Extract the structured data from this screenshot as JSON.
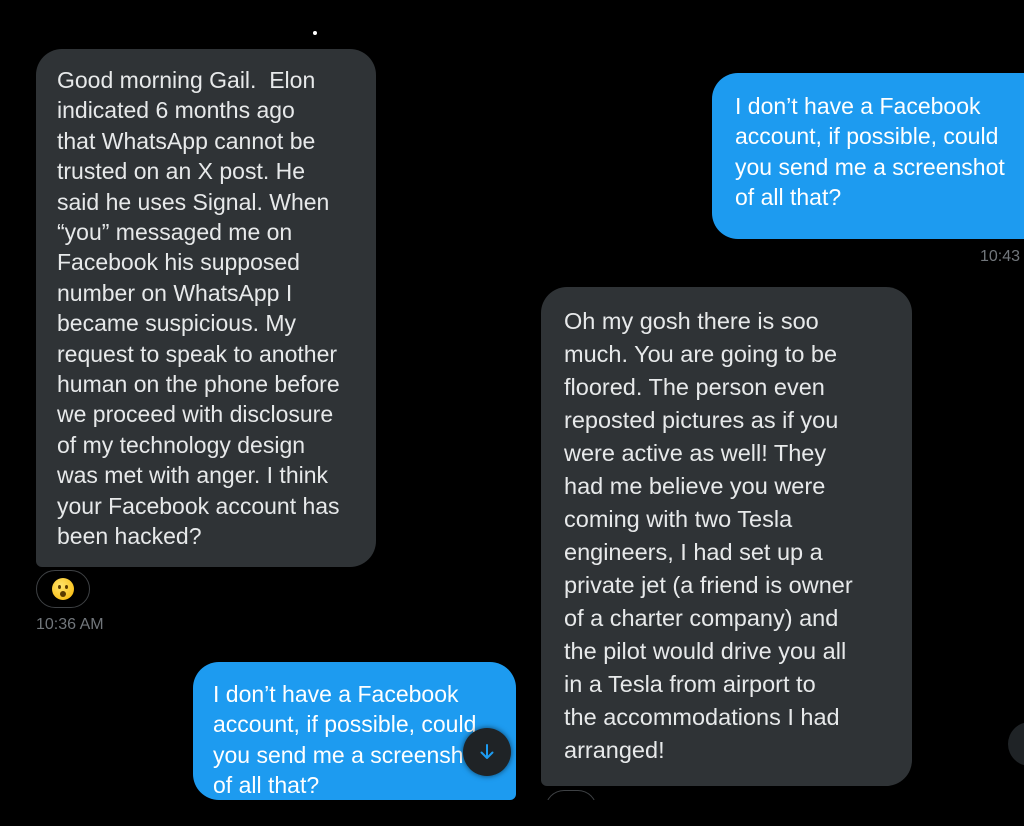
{
  "messages": {
    "gail": {
      "text": "Good morning Gail.  Elon\nindicated 6 months ago\nthat WhatsApp cannot be\ntrusted on an X post. He\nsaid he uses Signal. When\n“you” messaged me on\nFacebook his supposed\nnumber on WhatsApp I\nbecame suspicious. My\nrequest to speak to another\nhuman on the phone before\nwe proceed with disclosure\nof my technology design\nwas met with anger. I think\nyour Facebook account has\nbeen hacked?",
      "reaction": "astonished-face",
      "timestamp": "10:36 AM"
    },
    "outgoing_top": {
      "text": "I don’t have a Facebook\naccount, if possible, could\nyou send me a screenshot\nof all that?",
      "timestamp": "10:43"
    },
    "gosh": {
      "text": "Oh my gosh there is soo\nmuch. You are going to be\nfloored. The person even\nreposted pictures as if you\nwere active as well! They\nhad me believe you were\ncoming with two Tesla\nengineers, I had set up a\nprivate jet (a friend is owner\nof a charter company) and\nthe pilot would drive you all\nin a Tesla from airport to\nthe accommodations I had\narranged!"
    },
    "outgoing_bottom": {
      "text": "I don’t have a Facebook\naccount, if possible, could\nyou send me a screenshot\nof all that?"
    }
  },
  "controls": {
    "scroll_down_icon": "arrow-down-icon"
  },
  "colors": {
    "background": "#000000",
    "incoming_bubble": "#2f3336",
    "outgoing_bubble": "#1d9bf0",
    "timestamp": "#71767b"
  }
}
